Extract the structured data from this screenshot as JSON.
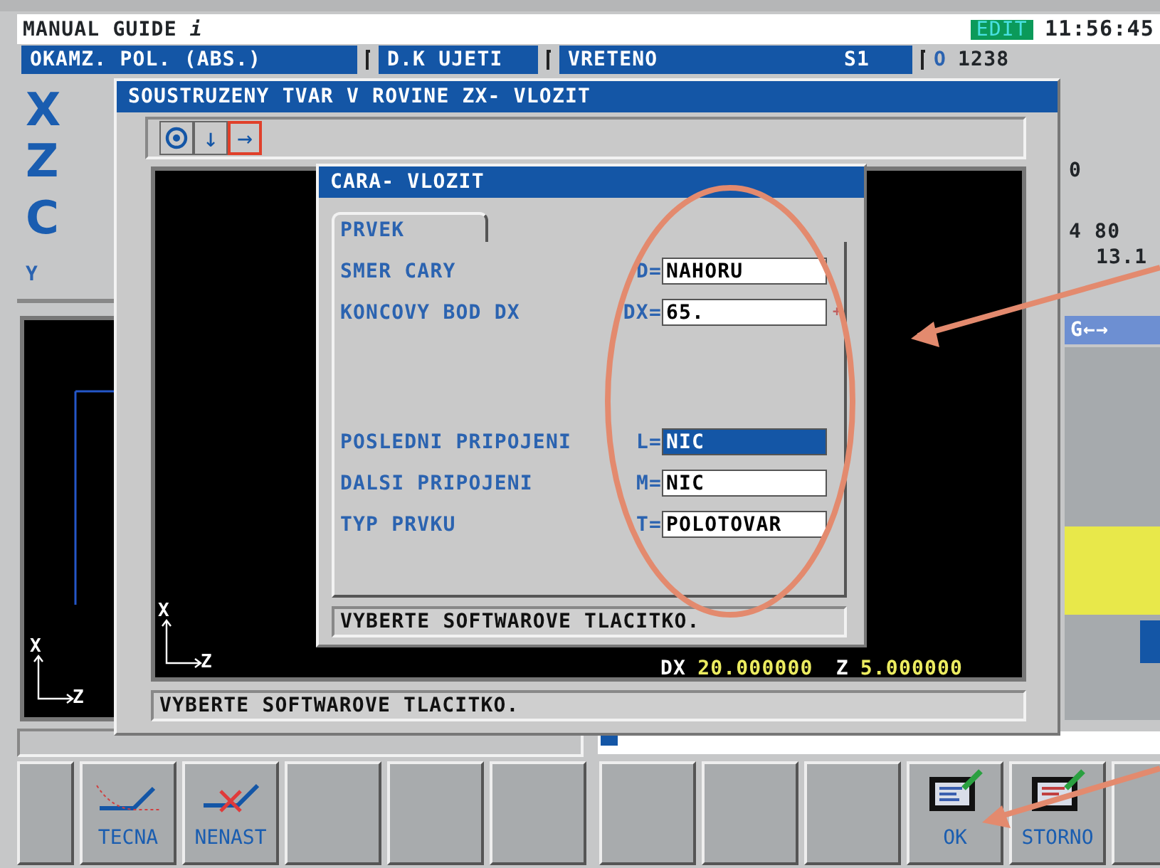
{
  "header": {
    "title": "MANUAL GUIDE *i*",
    "mode": "EDIT",
    "time": "11:56:45"
  },
  "status_tabs": [
    {
      "label": "OKAMZ. POL. (ABS.)"
    },
    {
      "label": "D.K UJETI"
    },
    {
      "label": "VRETENO",
      "value": "S1"
    }
  ],
  "program": {
    "prefix": "O",
    "number": "1238"
  },
  "axes": [
    {
      "label": "X",
      "kind": "major"
    },
    {
      "label": "Z",
      "kind": "major"
    },
    {
      "label": "C",
      "kind": "major"
    },
    {
      "label": "Y",
      "kind": "minor"
    }
  ],
  "left_graphics": {
    "vertical_axis": "X",
    "horizontal_axis": "Z"
  },
  "background_readouts": [
    "0",
    "4 80",
    "13.1"
  ],
  "background_tab": "G←→",
  "dialog": {
    "title": "SOUSTRUZENY TVAR V ROVINE ZX- VLOZIT",
    "tools": [
      {
        "kind": "circle",
        "selected": false
      },
      {
        "kind": "char",
        "glyph": "↓",
        "selected": false
      },
      {
        "kind": "char",
        "glyph": "→",
        "selected": true
      }
    ],
    "graphics": {
      "vertical_axis": "X",
      "horizontal_axis": "Z"
    },
    "readouts": [
      {
        "label": "DX",
        "value": "20.000000"
      },
      {
        "label": "Z",
        "value": "5.000000"
      }
    ],
    "message": "VYBERTE SOFTWAROVE TLACITKO."
  },
  "subdialog": {
    "title": "CARA- VLOZIT",
    "tabs": [
      {
        "label": "PRVEK",
        "selected": true
      }
    ],
    "field_groups": [
      [
        {
          "label": "SMER CARY",
          "prefix": "D=",
          "value": "NAHORU",
          "selected": false
        },
        {
          "label": "KONCOVY BOD DX",
          "prefix": "DX=",
          "value": "65.",
          "suffix": "+",
          "selected": false
        }
      ],
      [
        {
          "label": "POSLEDNI PRIPOJENI",
          "prefix": "L=",
          "value": "NIC",
          "selected": true
        },
        {
          "label": "DALSI PRIPOJENI",
          "prefix": "M=",
          "value": "NIC",
          "selected": false
        },
        {
          "label": "TYP PRVKU",
          "prefix": "T=",
          "value": "POLOTOVAR",
          "selected": false
        }
      ]
    ],
    "message": "VYBERTE SOFTWAROVE TLACITKO."
  },
  "progress": {
    "level": 0.03
  },
  "softkeys_left": [
    {
      "kind": "blank"
    },
    {
      "kind": "tangent",
      "label": "TECNA"
    },
    {
      "kind": "no-tangent",
      "label": "NENAST"
    },
    {
      "kind": "blank"
    },
    {
      "kind": "blank"
    },
    {
      "kind": "blank"
    }
  ],
  "softkeys_right": [
    {
      "kind": "blank"
    },
    {
      "kind": "blank"
    },
    {
      "kind": "blank"
    },
    {
      "kind": "ok",
      "label": "OK"
    },
    {
      "kind": "cancel",
      "label": "STORNO"
    },
    {
      "kind": "blank"
    }
  ]
}
